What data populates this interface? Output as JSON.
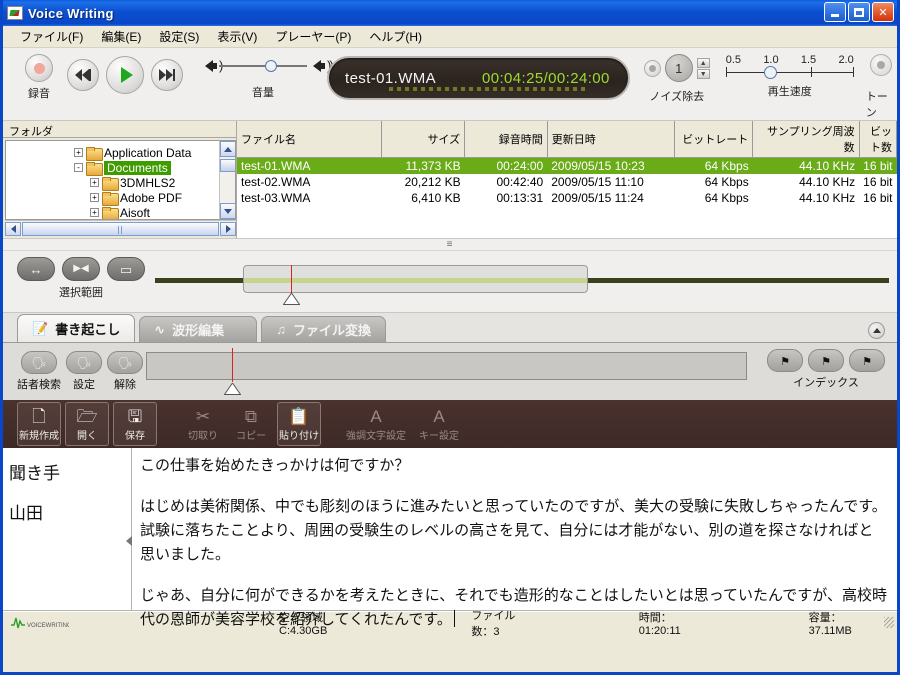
{
  "window": {
    "title": "Voice Writing",
    "minimize_label": "_",
    "maximize_label": "□",
    "close_label": "✕"
  },
  "menu": [
    {
      "label": "ファイル(F)"
    },
    {
      "label": "編集(E)"
    },
    {
      "label": "設定(S)"
    },
    {
      "label": "表示(V)"
    },
    {
      "label": "プレーヤー(P)"
    },
    {
      "label": "ヘルプ(H)"
    }
  ],
  "transport": {
    "record_label": "録音",
    "volume_label": "音量",
    "volume_value": 55,
    "display": {
      "filename": "test-01.WMA",
      "time": "00:04:25/00:24:00"
    },
    "noise": {
      "label": "ノイズ除去",
      "value": "1"
    },
    "speed": {
      "label": "再生速度",
      "ticks": [
        "0.5",
        "1.0",
        "1.5",
        "2.0"
      ],
      "value": "1.0"
    },
    "tone": {
      "label": "トーン"
    }
  },
  "explorer": {
    "tree_header": "フォルダ",
    "tree_items": [
      {
        "label": "Application Data",
        "expander": "+",
        "indent": 2,
        "selected": false
      },
      {
        "label": "Documents",
        "expander": "-",
        "indent": 2,
        "selected": true
      },
      {
        "label": "3DMHLS2",
        "expander": "+",
        "indent": 3,
        "selected": false
      },
      {
        "label": "Adobe PDF",
        "expander": "+",
        "indent": 3,
        "selected": false
      },
      {
        "label": "Aisoft",
        "expander": "+",
        "indent": 3,
        "selected": false
      }
    ],
    "columns": [
      {
        "label": "ファイル名",
        "align": "ta-l"
      },
      {
        "label": "サイズ",
        "align": "ta-r"
      },
      {
        "label": "録音時間",
        "align": "ta-r"
      },
      {
        "label": "更新日時",
        "align": "ta-l"
      },
      {
        "label": "ビットレート",
        "align": "ta-r"
      },
      {
        "label": "サンプリング周波数",
        "align": "ta-r"
      },
      {
        "label": "ビット数",
        "align": "ta-r"
      }
    ],
    "rows": [
      {
        "selected": true,
        "cells": [
          "test-01.WMA",
          "11,373 KB",
          "00:24:00",
          "2009/05/15 10:23",
          "64 Kbps",
          "44.10 KHz",
          "16 bit"
        ]
      },
      {
        "selected": false,
        "cells": [
          "test-02.WMA",
          "20,212 KB",
          "00:42:40",
          "2009/05/15 11:10",
          "64 Kbps",
          "44.10 KHz",
          "16 bit"
        ]
      },
      {
        "selected": false,
        "cells": [
          "test-03.WMA",
          "6,410 KB",
          "00:13:31",
          "2009/05/15 11:24",
          "64 Kbps",
          "44.10 KHz",
          "16 bit"
        ]
      }
    ]
  },
  "splitter": {
    "grip": "≡"
  },
  "selection": {
    "label": "選択範囲",
    "buttons": [
      {
        "icon": "↔",
        "name": "select-range-both"
      },
      {
        "icon": "▶◀",
        "name": "select-range-inner"
      },
      {
        "icon": "▭",
        "name": "select-range-clear"
      }
    ]
  },
  "tabs": [
    {
      "label": "書き起こし",
      "icon": "📝",
      "active": true
    },
    {
      "label": "波形編集",
      "icon": "∿",
      "active": false
    },
    {
      "label": "ファイル変換",
      "icon": "♫",
      "active": false
    }
  ],
  "speaker_row": {
    "buttons": [
      {
        "label": "話者検索",
        "icon": "🗣"
      },
      {
        "label": "設定",
        "icon": "🗣"
      },
      {
        "label": "解除",
        "icon": "🗣"
      }
    ],
    "index_label": "インデックス",
    "index_buttons": [
      {
        "icon": "⚑",
        "name": "index-add"
      },
      {
        "icon": "⚑",
        "name": "index-delete"
      },
      {
        "icon": "⚑",
        "name": "index-next"
      }
    ]
  },
  "toolbar": [
    {
      "label": "新規作成",
      "icon": "🗋",
      "enabled": true
    },
    {
      "label": "開く",
      "icon": "🗁",
      "enabled": true
    },
    {
      "label": "保存",
      "icon": "🖫",
      "enabled": true
    },
    {
      "label": "切取り",
      "icon": "✂",
      "enabled": false
    },
    {
      "label": "コピー",
      "icon": "⧉",
      "enabled": false
    },
    {
      "label": "貼り付け",
      "icon": "📋",
      "enabled": true
    },
    {
      "label": "強調文字設定",
      "icon": "A",
      "enabled": false
    },
    {
      "label": "キー設定",
      "icon": "A",
      "enabled": false
    }
  ],
  "editor": {
    "speakers": [
      "聞き手",
      "山田"
    ],
    "paragraphs": [
      "この仕事を始めたきっかけは何ですか？",
      "はじめは美術関係、中でも彫刻のほうに進みたいと思っていたのですが、美大の受験に失敗しちゃったんです。試験に落ちたことより、周囲の受験生のレベルの高さを見て、自分には才能がない、別の道を探さなければと思いました。",
      "じゃあ、自分に何ができるかを考えたときに、それでも造形的なことはしたいとは思っていたんですが、高校時代の恩師が美容学校を紹介してくれたんです。"
    ]
  },
  "statusbar": {
    "logo": "VOICE WRITING",
    "free_space": "空き領域 C:4.30GB",
    "file_count": "ファイル数：3",
    "time": "時間：01:20:11",
    "capacity": "容量：37.11MB"
  },
  "colors": {
    "title_blue": "#0a46c8",
    "selection_green": "#6aab18",
    "tree_select_green": "#3f9c00",
    "lcd_green": "#9ddb2f",
    "playhead_red": "#e02121",
    "toolbar_brown": "#4a322e"
  }
}
